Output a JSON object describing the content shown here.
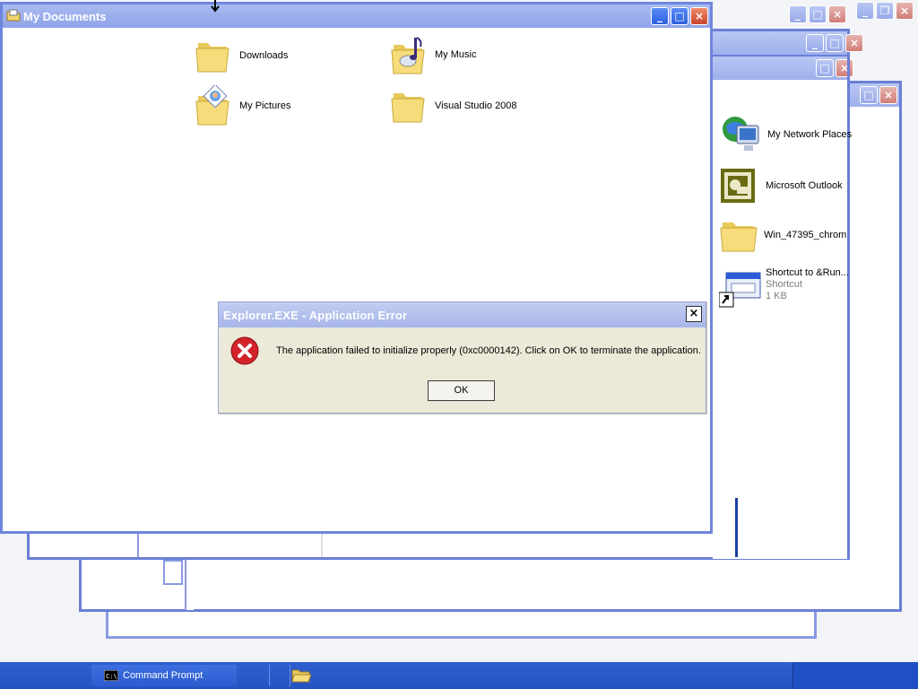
{
  "main_window": {
    "title": "My Documents",
    "items": [
      {
        "label": "Downloads",
        "icon": "folder-icon"
      },
      {
        "label": "My Music",
        "icon": "music-folder-icon"
      },
      {
        "label": "My Pictures",
        "icon": "pictures-folder-icon"
      },
      {
        "label": "Visual Studio 2008",
        "icon": "folder-icon"
      }
    ]
  },
  "side_window": {
    "items": [
      {
        "label": "My Network Places",
        "icon": "network-places-icon"
      },
      {
        "label": "Microsoft Outlook",
        "icon": "outlook-icon"
      },
      {
        "label": "Win_47395_chrom",
        "icon": "folder-icon"
      },
      {
        "label": "Shortcut to &Run...",
        "sub1": "Shortcut",
        "sub2": "1 KB",
        "icon": "shortcut-icon"
      }
    ]
  },
  "dialog": {
    "title": "Explorer.EXE - Application Error",
    "message": "The application failed to initialize properly (0xc0000142). Click on OK to terminate the application.",
    "ok_label": "OK",
    "close_glyph": "×"
  },
  "window_controls": {
    "minimize": "_",
    "maximize": "□",
    "close": "×",
    "restore": "❐"
  },
  "taskbar": {
    "items": [
      {
        "label": "Command Prompt",
        "icon": "command-prompt-icon"
      },
      {
        "label": "",
        "icon": "folder-open-icon"
      }
    ]
  },
  "colors": {
    "title_bar": "#a9bbf1",
    "window_border": "#6f86dd",
    "taskbar": "#2453c3",
    "dialog_face": "#ece9d8",
    "error_red": "#d2232a"
  }
}
